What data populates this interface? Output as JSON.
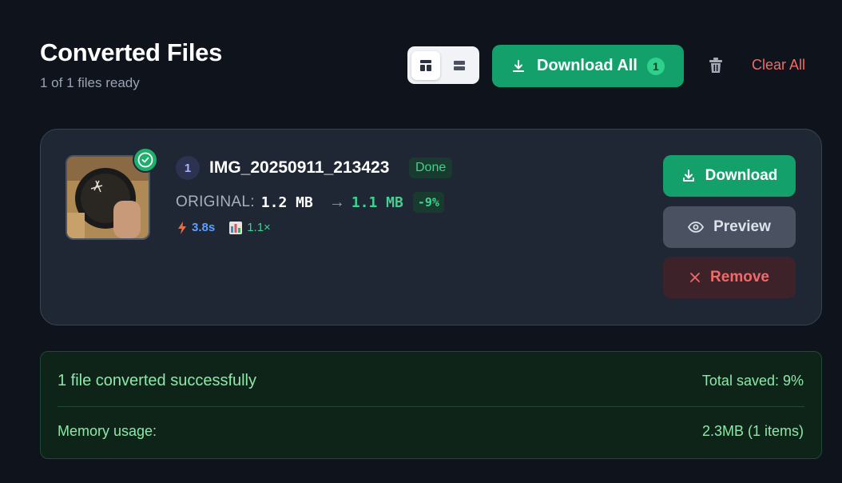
{
  "header": {
    "title": "Converted Files",
    "subtitle": "1 of 1 files ready"
  },
  "toolbar": {
    "view_modes": [
      {
        "icon": "layout-grid-icon",
        "active": true
      },
      {
        "icon": "layout-list-icon",
        "active": false
      }
    ],
    "download_all_label": "Download All",
    "download_all_count": "1",
    "trash_icon": "trash-icon",
    "clear_all_label": "Clear All"
  },
  "file": {
    "index": "1",
    "name": "IMG_20250911_213423",
    "status": "Done",
    "original_label": "ORIGINAL:",
    "original_size": "1.2 MB",
    "arrow": "→",
    "new_size": "1.1 MB",
    "change_pct": "-9%",
    "time": "3.8s",
    "ratio": "1.1×",
    "icons": {
      "status": "check-circle-icon",
      "time": "lightning-icon",
      "ratio": "bar-chart-icon"
    }
  },
  "actions": {
    "download_label": "Download",
    "preview_label": "Preview",
    "remove_label": "Remove"
  },
  "summary": {
    "title": "1 file converted successfully",
    "total_saved": "Total saved: 9%",
    "memory_label": "Memory usage:",
    "memory_value": "2.3MB (1 items)"
  },
  "colors": {
    "background": "#0f131c",
    "card": "#1f2634",
    "accent_green": "#14a06b",
    "success_text": "#3ed28f",
    "danger": "#f06a6a",
    "summary_bg": "#0f2419"
  }
}
